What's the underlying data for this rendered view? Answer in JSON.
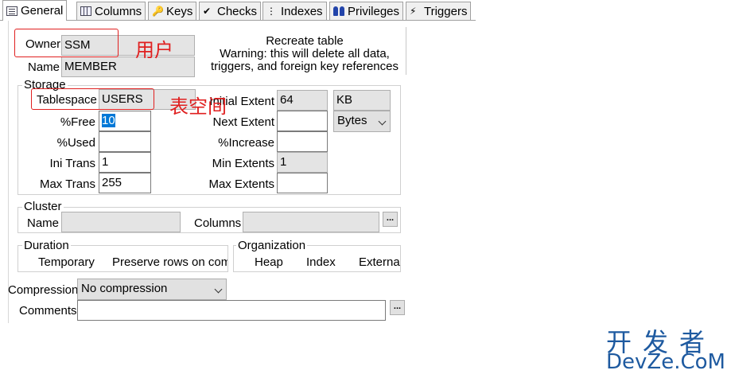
{
  "tabs": [
    {
      "label": "General",
      "icon": "general-doc-icon",
      "active": true
    },
    {
      "label": "Columns",
      "icon": "columns-icon",
      "active": false
    },
    {
      "label": "Keys",
      "icon": "keys-icon",
      "active": false
    },
    {
      "label": "Checks",
      "icon": "checks-icon",
      "active": false
    },
    {
      "label": "Indexes",
      "icon": "indexes-icon",
      "active": false
    },
    {
      "label": "Privileges",
      "icon": "privileges-icon",
      "active": false
    },
    {
      "label": "Triggers",
      "icon": "triggers-icon",
      "active": false
    }
  ],
  "general": {
    "owner_label": "Owner",
    "owner_value": "SSM",
    "name_label": "Name",
    "name_value": "MEMBER",
    "recreate_title": "Recreate table",
    "recreate_warning_1": "Warning: this will delete all data,",
    "recreate_warning_2": "triggers, and foreign key references"
  },
  "storage": {
    "title": "Storage",
    "tablespace_label": "Tablespace",
    "tablespace_value": "USERS",
    "pctfree_label": "%Free",
    "pctfree_value": "10",
    "pctused_label": "%Used",
    "pctused_value": "",
    "initrans_label": "Ini Trans",
    "initrans_value": "1",
    "maxtrans_label": "Max Trans",
    "maxtrans_value": "255",
    "initial_extent_label": "Initial Extent",
    "initial_extent_value": "64",
    "initial_extent_unit": "KB",
    "next_extent_label": "Next Extent",
    "next_extent_value": "",
    "next_extent_unit": "Bytes",
    "pctincrease_label": "%Increase",
    "pctincrease_value": "",
    "min_extents_label": "Min Extents",
    "min_extents_value": "1",
    "max_extents_label": "Max Extents",
    "max_extents_value": ""
  },
  "cluster": {
    "title": "Cluster",
    "name_label": "Name",
    "name_value": "",
    "columns_label": "Columns",
    "columns_value": "",
    "ellipsis": "..."
  },
  "duration": {
    "title": "Duration",
    "option_temporary": "Temporary",
    "option_preserve": "Preserve rows on com"
  },
  "organization": {
    "title": "Organization",
    "option_heap": "Heap",
    "option_index": "Index",
    "option_external": "External"
  },
  "compression": {
    "label": "Compression",
    "value": "No compression"
  },
  "comments": {
    "label": "Comments",
    "value": "",
    "ellipsis": "..."
  },
  "annotations": {
    "owner_note": "用户",
    "tablespace_note": "表空间",
    "annotation_color": "#e02020"
  },
  "watermark": {
    "line1": "开发者",
    "line2": "DevZe.CoM",
    "color": "#1e5aa0"
  }
}
